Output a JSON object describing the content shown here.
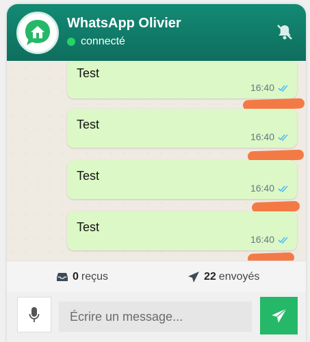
{
  "header": {
    "title": "WhatsApp Olivier",
    "status": "connecté",
    "avatar_icon": "house-chat-icon",
    "mute_icon": "bell-off-icon"
  },
  "messages": [
    {
      "text": "Test",
      "time": "16:40",
      "status_icon": "double-check-icon"
    },
    {
      "text": "Test",
      "time": "16:40",
      "status_icon": "double-check-icon"
    },
    {
      "text": "Test",
      "time": "16:40",
      "status_icon": "double-check-icon"
    },
    {
      "text": "Test",
      "time": "16:40",
      "status_icon": "double-check-icon"
    }
  ],
  "stats": {
    "received_count": "0",
    "received_label": "reçus",
    "sent_count": "22",
    "sent_label": "envoyés"
  },
  "composer": {
    "placeholder": "Écrire un message..."
  },
  "colors": {
    "header": "#128a74",
    "bubble": "#dcf8c6",
    "online": "#25d366",
    "send": "#25b868",
    "check": "#53bdeb",
    "redaction": "#f47a45"
  }
}
